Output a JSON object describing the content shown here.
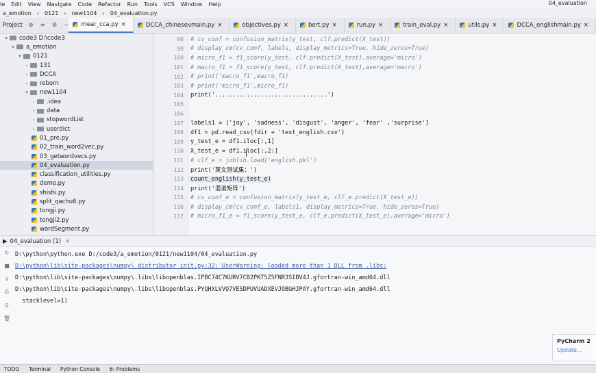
{
  "menu": [
    "le",
    "Edit",
    "View",
    "Navigate",
    "Code",
    "Refactor",
    "Run",
    "Tools",
    "VCS",
    "Window",
    "Help"
  ],
  "window_title": "04_evaluation",
  "breadcrumb": [
    "a_emotion",
    "0121",
    "new1104",
    "04_evaluation.py"
  ],
  "project_label": "Project",
  "tabs": [
    {
      "label": "mear_cca.py"
    },
    {
      "label": "DCCA_chinesevmain.py"
    },
    {
      "label": "objectives.py"
    },
    {
      "label": "bert.py"
    },
    {
      "label": "run.py"
    },
    {
      "label": "train_eval.py"
    },
    {
      "label": "utils.py"
    },
    {
      "label": "DCCA_englishmain.py"
    }
  ],
  "tree": [
    {
      "label": "code3  D:\\code3",
      "arrow": "▾",
      "kind": "folder"
    },
    {
      "label": "a_emotion",
      "arrow": "▾",
      "kind": "folder"
    },
    {
      "label": "0121",
      "arrow": "▾",
      "kind": "folder"
    },
    {
      "label": "131",
      "arrow": "›",
      "kind": "folder"
    },
    {
      "label": "DCCA",
      "arrow": "›",
      "kind": "folder"
    },
    {
      "label": "reborn",
      "arrow": "›",
      "kind": "folder"
    },
    {
      "label": "new1104",
      "arrow": "▾",
      "kind": "folder"
    },
    {
      "label": ".idea",
      "arrow": "›",
      "kind": "folder"
    },
    {
      "label": "data",
      "arrow": "›",
      "kind": "folder"
    },
    {
      "label": "stopwordList",
      "arrow": "›",
      "kind": "folder"
    },
    {
      "label": "userdict",
      "arrow": "›",
      "kind": "folder"
    },
    {
      "label": "01_pre.py",
      "arrow": "",
      "kind": "py"
    },
    {
      "label": "02_train_word2vec.py",
      "arrow": "",
      "kind": "py"
    },
    {
      "label": "03_getwordvecs.py",
      "arrow": "",
      "kind": "py"
    },
    {
      "label": "04_evaluation.py",
      "arrow": "",
      "kind": "py",
      "selected": true
    },
    {
      "label": "classification_utilities.py",
      "arrow": "",
      "kind": "py"
    },
    {
      "label": "demo.py",
      "arrow": "",
      "kind": "py"
    },
    {
      "label": "shishi.py",
      "arrow": "",
      "kind": "py"
    },
    {
      "label": "split_qachu6.py",
      "arrow": "",
      "kind": "py"
    },
    {
      "label": "tongji.py",
      "arrow": "",
      "kind": "py"
    },
    {
      "label": "tongji2.py",
      "arrow": "",
      "kind": "py"
    },
    {
      "label": "wordSegment.py",
      "arrow": "",
      "kind": "py"
    }
  ],
  "code": [
    {
      "n": "98",
      "text": "# cv_conf = confusion_matrix(y_test, clf.predict(X_test))",
      "comment": true
    },
    {
      "n": "99",
      "text": "# display_cm(cv_conf, labels, display_metrics=True, hide_zeros=True)",
      "comment": true
    },
    {
      "n": "100",
      "text": "# micro_f1 = f1_score(y_test, clf.predict(X_test),average='micro')",
      "comment": true
    },
    {
      "n": "101",
      "text": "# macro_f1 = f1_score(y_test, clf.predict(X_test),average='macro')",
      "comment": true
    },
    {
      "n": "102",
      "text": "# print('macro_f1',macro_f1)",
      "comment": true
    },
    {
      "n": "103",
      "text": "# print('micro_f1',micro_f1)",
      "comment": true
    },
    {
      "n": "104",
      "text": "print('................................')",
      "comment": false
    },
    {
      "n": "105",
      "text": "",
      "comment": false
    },
    {
      "n": "106",
      "text": "",
      "comment": false
    },
    {
      "n": "107",
      "text": "labels1 = ['joy', 'sadness', 'disgust', 'anger', 'fear' ,'surprise']",
      "comment": false
    },
    {
      "n": "108",
      "text": "df1 = pd.read_csv(fdir + 'test_english.csv')",
      "comment": false
    },
    {
      "n": "109",
      "text": "y_test_e = df1.iloc[:,1]",
      "comment": false
    },
    {
      "n": "110",
      "text": "X_test_e = df1.iloc[:,2:]",
      "comment": false
    },
    {
      "n": "111",
      "text": "# clf_e = joblib.load('english.pkl')",
      "comment": true
    },
    {
      "n": "112",
      "text": "print('英文测试集：')",
      "comment": false
    },
    {
      "n": "113",
      "text": "count_english(y_test_e)",
      "comment": false,
      "highlight": true
    },
    {
      "n": "114",
      "text": "print('混淆矩阵')",
      "comment": false
    },
    {
      "n": "115",
      "text": "# cv_conf_e = confusion_matrix(y_test_e, clf_e.predict(X_test_e))",
      "comment": true
    },
    {
      "n": "116",
      "text": "# display_cm(cv_conf_e, labels1, display_metrics=True, hide_zeros=True)",
      "comment": true
    },
    {
      "n": "117",
      "text": "# micro_f1_e = f1_score(y_test_e, clf_e.predict(X_test_e),average='micro')",
      "comment": true
    }
  ],
  "run": {
    "tab_label": "04_evaluation (1)",
    "lines": [
      {
        "text": "D:\\python\\python.exe D:/code3/a_emotion/0121/new1104/04_evaluation.py",
        "link": false
      },
      {
        "text": "D:\\python\\lib\\site-packages\\numpy\\_distributor_init.py:32: UserWarning: loaded more than 1 DLL from .libs:",
        "link": true
      },
      {
        "text": "D:\\python\\lib\\site-packages\\numpy\\.libs\\libopenblas.IPBC74C7KURV7CB2PKT5Z5FNR3SIBV4J.gfortran-win_amd64.dll",
        "link": false
      },
      {
        "text": "D:\\python\\lib\\site-packages\\numpy\\.libs\\libopenblas.PYQHXLVVQ7VESDPUVUADXEVJOBGHJPAY.gfortran-win_amd64.dll",
        "link": false
      },
      {
        "text": "  stacklevel=1)",
        "link": false
      }
    ]
  },
  "notification": {
    "title": "PyCharm 2",
    "action": "Update..."
  },
  "status": [
    "TODO",
    "Terminal",
    "Python Console",
    "6: Problems"
  ]
}
